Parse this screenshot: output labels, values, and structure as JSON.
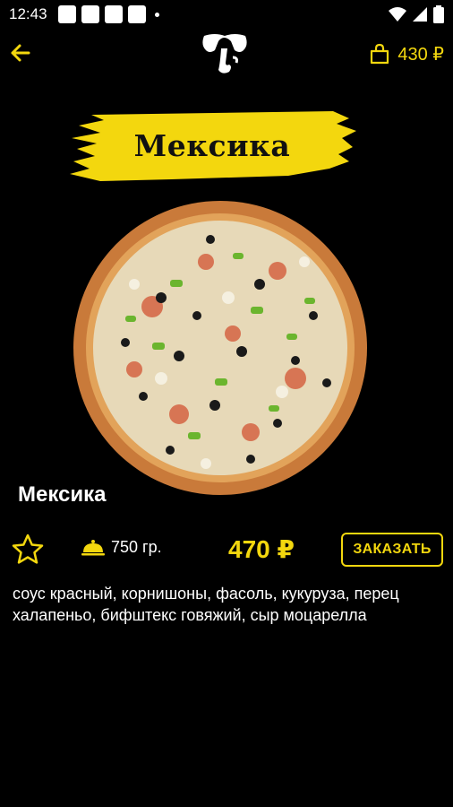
{
  "status_bar": {
    "time": "12:43"
  },
  "header": {
    "cart_total": "430 ₽"
  },
  "product": {
    "banner_title": "Мексика",
    "name": "Мексика",
    "weight": "750 гр.",
    "price": "470 ₽",
    "order_label": "ЗАКАЗАТЬ",
    "description": "соус красный, корнишоны, фасоль, кукуруза, перец халапеньо, бифштекс говяжий, сыр моцарелла"
  },
  "colors": {
    "accent": "#f3d70e",
    "background": "#000000"
  },
  "icons": {
    "back": "arrow-left-icon",
    "logo": "elephant-logo",
    "cart": "shopping-bag-icon",
    "favorite": "star-icon",
    "weight": "dish-cloche-icon"
  }
}
